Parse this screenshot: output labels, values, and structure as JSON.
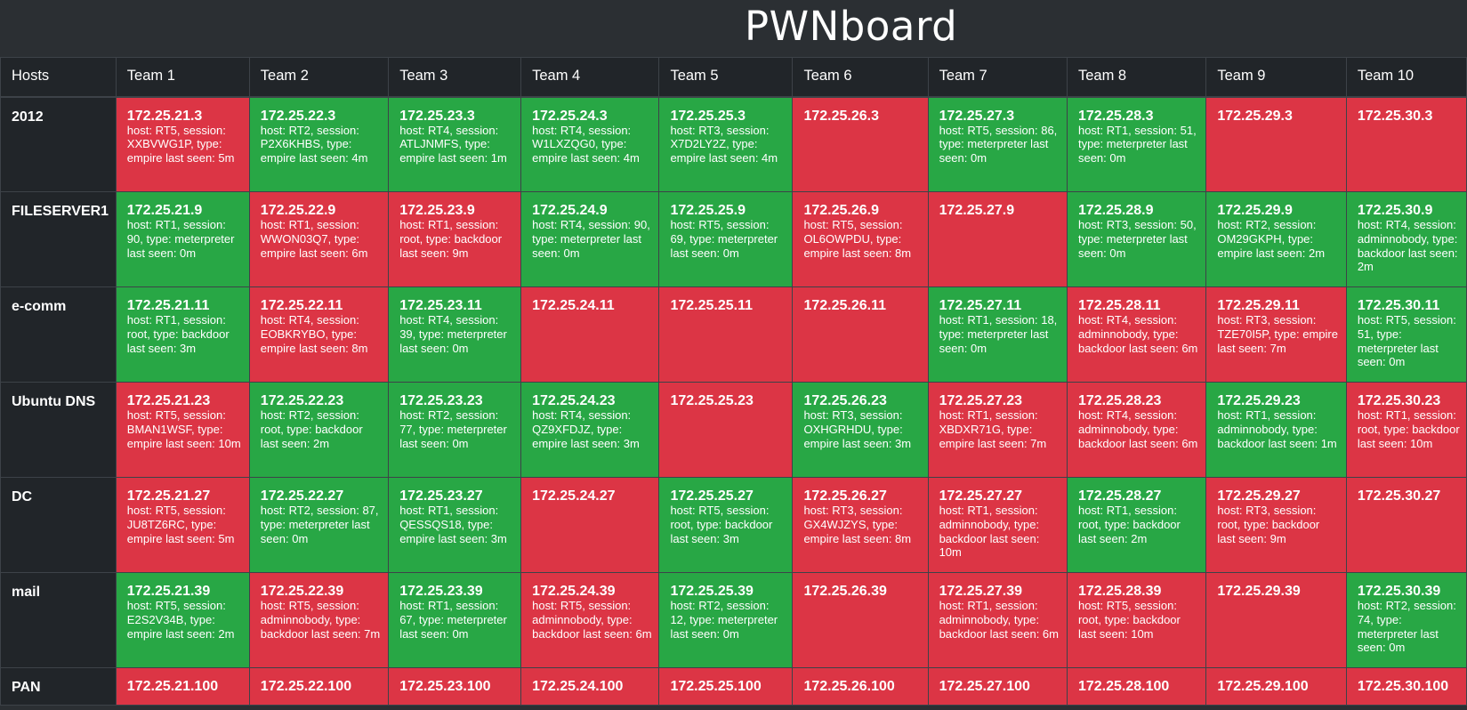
{
  "app": {
    "title": "PWNboard"
  },
  "colors": {
    "background": "#2b2f33",
    "header_cell": "#212529",
    "online": "#28a745",
    "offline": "#dc3545"
  },
  "table": {
    "hosts_header": "Hosts",
    "teams": [
      "Team 1",
      "Team 2",
      "Team 3",
      "Team 4",
      "Team 5",
      "Team 6",
      "Team 7",
      "Team 8",
      "Team 9",
      "Team 10"
    ],
    "rows": [
      {
        "host": "2012",
        "cells": [
          {
            "ip": "172.25.21.3",
            "status": "up-red",
            "info": "host: RT5, session: XXBVWG1P, type: empire last seen: 5m"
          },
          {
            "ip": "172.25.22.3",
            "status": "up",
            "info": "host: RT2, session: P2X6KHBS, type: empire last seen: 4m"
          },
          {
            "ip": "172.25.23.3",
            "status": "up",
            "info": "host: RT4, session: ATLJNMFS, type: empire last seen: 1m"
          },
          {
            "ip": "172.25.24.3",
            "status": "up",
            "info": "host: RT4, session: W1LXZQG0, type: empire last seen: 4m"
          },
          {
            "ip": "172.25.25.3",
            "status": "up",
            "info": "host: RT3, session: X7D2LY2Z, type: empire last seen: 4m"
          },
          {
            "ip": "172.25.26.3",
            "status": "down",
            "info": ""
          },
          {
            "ip": "172.25.27.3",
            "status": "up",
            "info": "host: RT5, session: 86, type: meterpreter last seen: 0m"
          },
          {
            "ip": "172.25.28.3",
            "status": "up",
            "info": "host: RT1, session: 51, type: meterpreter last seen: 0m"
          },
          {
            "ip": "172.25.29.3",
            "status": "down",
            "info": ""
          },
          {
            "ip": "172.25.30.3",
            "status": "down",
            "info": ""
          }
        ]
      },
      {
        "host": "FILESERVER1",
        "cells": [
          {
            "ip": "172.25.21.9",
            "status": "up",
            "info": "host: RT1, session: 90, type: meterpreter last seen: 0m"
          },
          {
            "ip": "172.25.22.9",
            "status": "up-red",
            "info": "host: RT1, session: WWON03Q7, type: empire last seen: 6m"
          },
          {
            "ip": "172.25.23.9",
            "status": "up-red",
            "info": "host: RT1, session: root, type: backdoor last seen: 9m"
          },
          {
            "ip": "172.25.24.9",
            "status": "up",
            "info": "host: RT4, session: 90, type: meterpreter last seen: 0m"
          },
          {
            "ip": "172.25.25.9",
            "status": "up",
            "info": "host: RT5, session: 69, type: meterpreter last seen: 0m"
          },
          {
            "ip": "172.25.26.9",
            "status": "up-red",
            "info": "host: RT5, session: OL6OWPDU, type: empire last seen: 8m"
          },
          {
            "ip": "172.25.27.9",
            "status": "down",
            "info": ""
          },
          {
            "ip": "172.25.28.9",
            "status": "up",
            "info": "host: RT3, session: 50, type: meterpreter last seen: 0m"
          },
          {
            "ip": "172.25.29.9",
            "status": "up",
            "info": "host: RT2, session: OM29GKPH, type: empire last seen: 2m"
          },
          {
            "ip": "172.25.30.9",
            "status": "up",
            "info": "host: RT4, session: adminnobody, type: backdoor last seen: 2m"
          }
        ]
      },
      {
        "host": "e-comm",
        "cells": [
          {
            "ip": "172.25.21.11",
            "status": "up",
            "info": "host: RT1, session: root, type: backdoor last seen: 3m"
          },
          {
            "ip": "172.25.22.11",
            "status": "up-red",
            "info": "host: RT4, session: EOBKRYBO, type: empire last seen: 8m"
          },
          {
            "ip": "172.25.23.11",
            "status": "up",
            "info": "host: RT4, session: 39, type: meterpreter last seen: 0m"
          },
          {
            "ip": "172.25.24.11",
            "status": "down",
            "info": ""
          },
          {
            "ip": "172.25.25.11",
            "status": "down",
            "info": ""
          },
          {
            "ip": "172.25.26.11",
            "status": "down",
            "info": ""
          },
          {
            "ip": "172.25.27.11",
            "status": "up",
            "info": "host: RT1, session: 18, type: meterpreter last seen: 0m"
          },
          {
            "ip": "172.25.28.11",
            "status": "up-red",
            "info": "host: RT4, session: adminnobody, type: backdoor last seen: 6m"
          },
          {
            "ip": "172.25.29.11",
            "status": "up-red",
            "info": "host: RT3, session: TZE70I5P, type: empire last seen: 7m"
          },
          {
            "ip": "172.25.30.11",
            "status": "up",
            "info": "host: RT5, session: 51, type: meterpreter last seen: 0m"
          }
        ]
      },
      {
        "host": "Ubuntu DNS",
        "cells": [
          {
            "ip": "172.25.21.23",
            "status": "up-red",
            "info": "host: RT5, session: BMAN1WSF, type: empire last seen: 10m"
          },
          {
            "ip": "172.25.22.23",
            "status": "up",
            "info": "host: RT2, session: root, type: backdoor last seen: 2m"
          },
          {
            "ip": "172.25.23.23",
            "status": "up",
            "info": "host: RT2, session: 77, type: meterpreter last seen: 0m"
          },
          {
            "ip": "172.25.24.23",
            "status": "up",
            "info": "host: RT4, session: QZ9XFDJZ, type: empire last seen: 3m"
          },
          {
            "ip": "172.25.25.23",
            "status": "down",
            "info": ""
          },
          {
            "ip": "172.25.26.23",
            "status": "up",
            "info": "host: RT3, session: OXHGRHDU, type: empire last seen: 3m"
          },
          {
            "ip": "172.25.27.23",
            "status": "up-red",
            "info": "host: RT1, session: XBDXR71G, type: empire last seen: 7m"
          },
          {
            "ip": "172.25.28.23",
            "status": "up-red",
            "info": "host: RT4, session: adminnobody, type: backdoor last seen: 6m"
          },
          {
            "ip": "172.25.29.23",
            "status": "up",
            "info": "host: RT1, session: adminnobody, type: backdoor last seen: 1m"
          },
          {
            "ip": "172.25.30.23",
            "status": "up-red",
            "info": "host: RT1, session: root, type: backdoor last seen: 10m"
          }
        ]
      },
      {
        "host": "DC",
        "cells": [
          {
            "ip": "172.25.21.27",
            "status": "up-red",
            "info": "host: RT5, session: JU8TZ6RC, type: empire last seen: 5m"
          },
          {
            "ip": "172.25.22.27",
            "status": "up",
            "info": "host: RT2, session: 87, type: meterpreter last seen: 0m"
          },
          {
            "ip": "172.25.23.27",
            "status": "up",
            "info": "host: RT1, session: QESSQS18, type: empire last seen: 3m"
          },
          {
            "ip": "172.25.24.27",
            "status": "down",
            "info": ""
          },
          {
            "ip": "172.25.25.27",
            "status": "up",
            "info": "host: RT5, session: root, type: backdoor last seen: 3m"
          },
          {
            "ip": "172.25.26.27",
            "status": "up-red",
            "info": "host: RT3, session: GX4WJZYS, type: empire last seen: 8m"
          },
          {
            "ip": "172.25.27.27",
            "status": "up-red",
            "info": "host: RT1, session: adminnobody, type: backdoor last seen: 10m"
          },
          {
            "ip": "172.25.28.27",
            "status": "up",
            "info": "host: RT1, session: root, type: backdoor last seen: 2m"
          },
          {
            "ip": "172.25.29.27",
            "status": "up-red",
            "info": "host: RT3, session: root, type: backdoor last seen: 9m"
          },
          {
            "ip": "172.25.30.27",
            "status": "down",
            "info": ""
          }
        ]
      },
      {
        "host": "mail",
        "cells": [
          {
            "ip": "172.25.21.39",
            "status": "up",
            "info": "host: RT5, session: E2S2V34B, type: empire last seen: 2m"
          },
          {
            "ip": "172.25.22.39",
            "status": "up-red",
            "info": "host: RT5, session: adminnobody, type: backdoor last seen: 7m"
          },
          {
            "ip": "172.25.23.39",
            "status": "up",
            "info": "host: RT1, session: 67, type: meterpreter last seen: 0m"
          },
          {
            "ip": "172.25.24.39",
            "status": "up-red",
            "info": "host: RT5, session: adminnobody, type: backdoor last seen: 6m"
          },
          {
            "ip": "172.25.25.39",
            "status": "up",
            "info": "host: RT2, session: 12, type: meterpreter last seen: 0m"
          },
          {
            "ip": "172.25.26.39",
            "status": "down",
            "info": ""
          },
          {
            "ip": "172.25.27.39",
            "status": "up-red",
            "info": "host: RT1, session: adminnobody, type: backdoor last seen: 6m"
          },
          {
            "ip": "172.25.28.39",
            "status": "up-red",
            "info": "host: RT5, session: root, type: backdoor last seen: 10m"
          },
          {
            "ip": "172.25.29.39",
            "status": "down",
            "info": ""
          },
          {
            "ip": "172.25.30.39",
            "status": "up",
            "info": "host: RT2, session: 74, type: meterpreter last seen: 0m"
          }
        ]
      },
      {
        "host": "PAN",
        "cells": [
          {
            "ip": "172.25.21.100",
            "status": "down",
            "info": ""
          },
          {
            "ip": "172.25.22.100",
            "status": "down",
            "info": ""
          },
          {
            "ip": "172.25.23.100",
            "status": "down",
            "info": ""
          },
          {
            "ip": "172.25.24.100",
            "status": "down",
            "info": ""
          },
          {
            "ip": "172.25.25.100",
            "status": "down",
            "info": ""
          },
          {
            "ip": "172.25.26.100",
            "status": "down",
            "info": ""
          },
          {
            "ip": "172.25.27.100",
            "status": "down",
            "info": ""
          },
          {
            "ip": "172.25.28.100",
            "status": "down",
            "info": ""
          },
          {
            "ip": "172.25.29.100",
            "status": "down",
            "info": ""
          },
          {
            "ip": "172.25.30.100",
            "status": "down",
            "info": ""
          }
        ]
      }
    ]
  }
}
